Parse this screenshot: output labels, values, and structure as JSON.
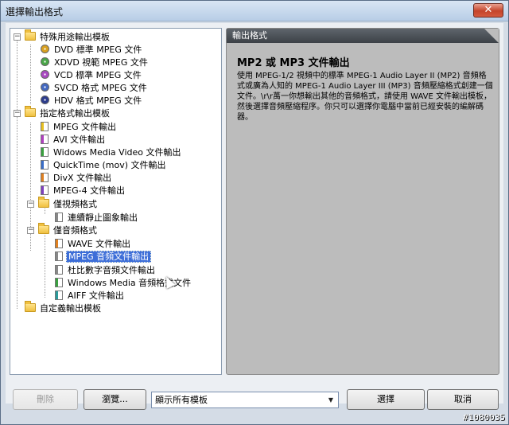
{
  "window": {
    "title": "選擇輸出格式",
    "close_glyph": "✕"
  },
  "tree": {
    "groups": [
      {
        "label": "特殊用途輸出模板",
        "items": [
          {
            "label": "DVD 標準 MPEG 文件",
            "icon": "disc-icon"
          },
          {
            "label": "XDVD 視範 MPEG 文件",
            "icon": "disc-icon"
          },
          {
            "label": "VCD 標準 MPEG 文件",
            "icon": "disc-icon"
          },
          {
            "label": "SVCD 格式 MPEG 文件",
            "icon": "disc-icon"
          },
          {
            "label": "HDV 格式 MPEG 文件",
            "icon": "disc-icon"
          }
        ]
      },
      {
        "label": "指定格式輸出模板",
        "items": [
          {
            "label": "MPEG 文件輸出"
          },
          {
            "label": "AVI 文件輸出"
          },
          {
            "label": "Widows Media Video 文件輸出"
          },
          {
            "label": "QuickTime (mov) 文件輸出"
          },
          {
            "label": "DivX 文件輸出"
          },
          {
            "label": "MPEG-4 文件輸出"
          }
        ],
        "subgroups": [
          {
            "label": "僅視頻格式",
            "items": [
              {
                "label": "連續靜止圖象輸出"
              }
            ]
          },
          {
            "label": "僅音頻格式",
            "items": [
              {
                "label": "WAVE 文件輸出"
              },
              {
                "label": "MPEG 音頻文件輸出"
              },
              {
                "label": "杜比數字音頻文件輸出"
              },
              {
                "label": "Windows Media 音頻格式文件"
              },
              {
                "label": "AIFF 文件輸出"
              }
            ]
          }
        ]
      },
      {
        "label": "自定義輸出模板",
        "items": []
      }
    ],
    "selected": "MPEG 音頻文件輸出"
  },
  "description": {
    "header": "輸出格式",
    "title": "MP2 或 MP3 文件輸出",
    "body": "使用 MPEG-1/2 視頻中的標準 MPEG-1 Audio Layer II (MP2) 音頻格式或廣為人知的 MPEG-1 Audio Layer III (MP3) 音頻壓縮格式創建一個文件。\\r\\r萬一你想輸出其他的音頻格式，請使用 WAVE 文件輸出模板，然後選擇音頻壓縮程序。你只可以選擇你電腦中當前已經安裝的編解碼器。"
  },
  "buttons": {
    "delete": "刪除",
    "browse": "瀏覽...",
    "select": "選擇",
    "cancel": "取消"
  },
  "filter": {
    "selected": "顯示所有模板"
  },
  "watermark": "#1080035"
}
